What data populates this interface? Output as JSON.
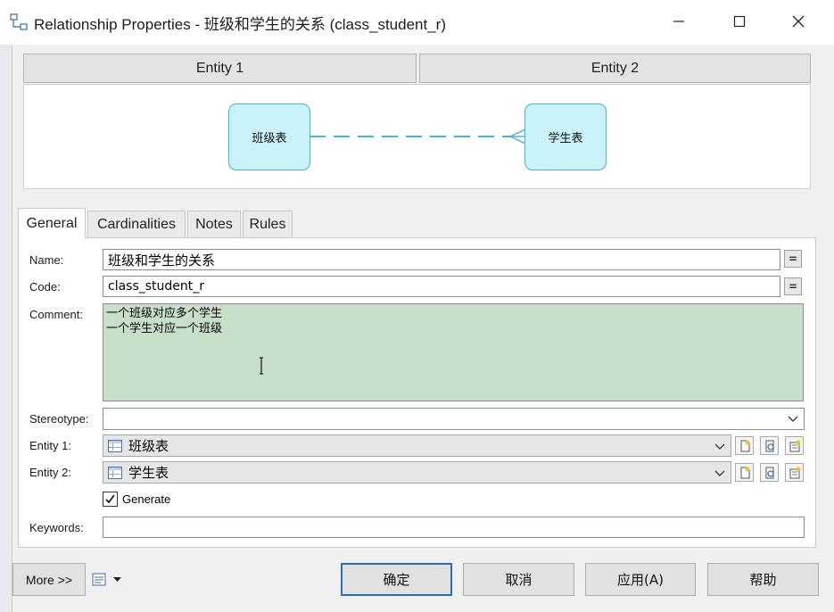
{
  "window": {
    "title": "Relationship Properties - 班级和学生的关系 (class_student_r)",
    "controls": {
      "minimize": "minimize",
      "maximize": "maximize",
      "close": "close"
    }
  },
  "diagram": {
    "entity1_header": "Entity 1",
    "entity2_header": "Entity 2",
    "entity1_name": "班级表",
    "entity2_name": "学生表",
    "relationship_line_color": "#4ab3cf"
  },
  "tabs": [
    {
      "label": "General",
      "active": true
    },
    {
      "label": "Cardinalities",
      "active": false
    },
    {
      "label": "Notes",
      "active": false
    },
    {
      "label": "Rules",
      "active": false
    }
  ],
  "form": {
    "name_label": "Name:",
    "name_value": "班级和学生的关系",
    "code_label": "Code:",
    "code_value": "class_student_r",
    "ellipsis_button": "=",
    "comment_label": "Comment:",
    "comment_value": "一个班级对应多个学生\n一个学生对应一个班级",
    "stereotype_label": "Stereotype:",
    "stereotype_value": "",
    "entity1_label": "Entity 1:",
    "entity1_value": "班级表",
    "entity2_label": "Entity 2:",
    "entity2_value": "学生表",
    "generate_label": "Generate",
    "generate_checked": true,
    "keywords_label": "Keywords:",
    "keywords_value": ""
  },
  "footer": {
    "more_button": "More >>",
    "ok_button": "确定",
    "cancel_button": "取消",
    "apply_button": "应用(A)",
    "help_button": "帮助"
  },
  "colors": {
    "comment_bg": "#c7dfc9",
    "entity_fill": "#c9f2fa",
    "entity_border": "#4ab3cf",
    "default_button_border": "#2d6fb5"
  }
}
